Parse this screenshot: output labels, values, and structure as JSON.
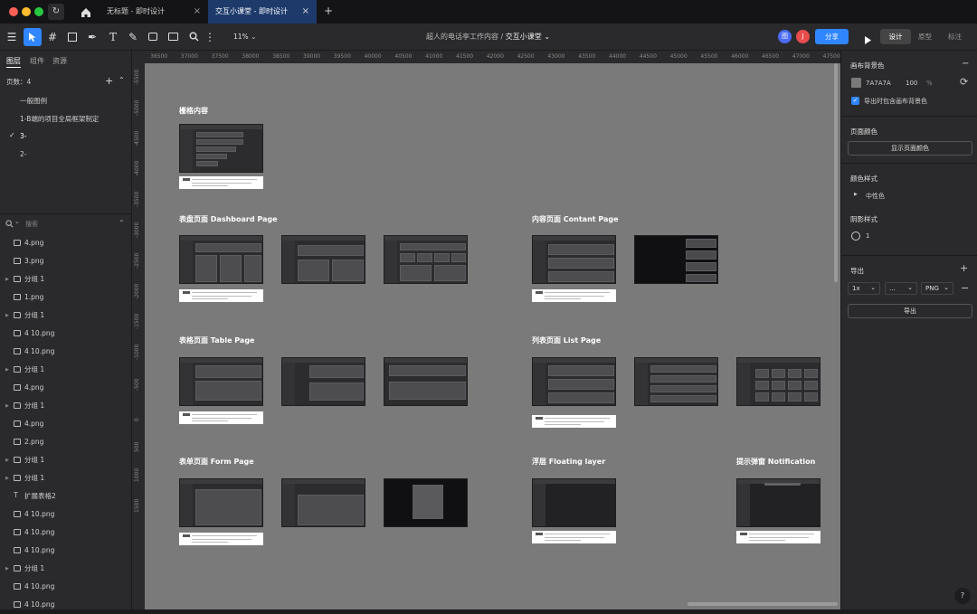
{
  "window": {
    "traffic_lights": [
      "#ff5f57",
      "#febc2e",
      "#28c840"
    ],
    "tabs": [
      {
        "label": "无标题 - 即时设计",
        "active": false
      },
      {
        "label": "交互小课堂 - 即时设计",
        "active": true
      }
    ],
    "new_tab": "+"
  },
  "toolbar": {
    "zoom": "11%",
    "breadcrumb_project": "超人的电话亭工作内容",
    "breadcrumb_sep": "/",
    "breadcrumb_file": "交互小课堂",
    "avatar1": "图",
    "avatar2": "J",
    "share_label": "分享",
    "mode_design": "设计",
    "mode_prototype": "原型",
    "mode_annotate": "标注",
    "colors": {
      "accent": "#2f86ff",
      "avatar1": "#4a6cf7",
      "avatar2": "#e84d4d"
    }
  },
  "left_panel": {
    "tabs": [
      "图层",
      "组件",
      "资源"
    ],
    "pages_label": "页数：",
    "pages_count": "4",
    "pages": [
      {
        "name": "一般图例",
        "checked": false
      },
      {
        "name": "1-B端的项目全局框架制定",
        "checked": false
      },
      {
        "name": "3-",
        "checked": true
      },
      {
        "name": "2-",
        "checked": false
      }
    ],
    "search_placeholder": "搜索",
    "layers": [
      {
        "name": "4.png",
        "type": "image",
        "expandable": false
      },
      {
        "name": "3.png",
        "type": "image",
        "expandable": false
      },
      {
        "name": "分组 1",
        "type": "folder",
        "expandable": true
      },
      {
        "name": "1.png",
        "type": "image",
        "expandable": false
      },
      {
        "name": "分组 1",
        "type": "folder",
        "expandable": true
      },
      {
        "name": "4 10.png",
        "type": "image",
        "expandable": false
      },
      {
        "name": "4 10.png",
        "type": "image",
        "expandable": false
      },
      {
        "name": "分组 1",
        "type": "folder",
        "expandable": true
      },
      {
        "name": "4.png",
        "type": "image",
        "expandable": false
      },
      {
        "name": "分组 1",
        "type": "folder",
        "expandable": true
      },
      {
        "name": "4.png",
        "type": "image",
        "expandable": false
      },
      {
        "name": "2.png",
        "type": "image",
        "expandable": false
      },
      {
        "name": "分组 1",
        "type": "folder",
        "expandable": true
      },
      {
        "name": "分组 1",
        "type": "folder",
        "expandable": true
      },
      {
        "name": "扩展表格2",
        "type": "text",
        "expandable": false
      },
      {
        "name": "4 10.png",
        "type": "image",
        "expandable": false
      },
      {
        "name": "4 10.png",
        "type": "image",
        "expandable": false
      },
      {
        "name": "4 10.png",
        "type": "image",
        "expandable": false
      },
      {
        "name": "分组 1",
        "type": "folder",
        "expandable": true
      },
      {
        "name": "4 10.png",
        "type": "image",
        "expandable": false
      },
      {
        "name": "4 10.png",
        "type": "image",
        "expandable": false
      }
    ]
  },
  "rulers": {
    "top": [
      "36500",
      "37000",
      "37500",
      "38000",
      "38500",
      "39000",
      "39500",
      "40000",
      "40500",
      "41000",
      "41500",
      "42000",
      "42500",
      "43000",
      "43500",
      "44000",
      "44500",
      "45000",
      "45500",
      "46000",
      "46500",
      "47000",
      "47500"
    ],
    "left": [
      "-5500",
      "-5000",
      "-4500",
      "-4000",
      "-3500",
      "-3000",
      "-2500",
      "-2000",
      "-1500",
      "-1000",
      "-500",
      "0",
      "500",
      "1000",
      "1500"
    ]
  },
  "canvas": {
    "background": "#7a7a7a",
    "sections": {
      "grid": "栅格内容",
      "dashboard": "表盘页面 Dashboard Page",
      "content": "内容页面 Contant Page",
      "table": "表格页面 Table Page",
      "list": "列表页面 List Page",
      "form": "表单页面 Form Page",
      "floating": "浮层 Floating layer",
      "notification": "提示弹窗 Notification"
    }
  },
  "right_panel": {
    "canvas_bg_label": "画布背景色",
    "canvas_bg_hex": "7A7A7A",
    "canvas_bg_opacity": "100",
    "percent": "%",
    "export_include_bg": "导出时包含画布背景色",
    "page_color_label": "页面颜色",
    "page_color_button": "显示页面颜色",
    "color_styles_label": "颜色样式",
    "color_style_item": "中性色",
    "shadow_styles_label": "阴影样式",
    "shadow_count": "1",
    "export_label": "导出",
    "export_scale": "1x",
    "export_suffix": "...",
    "export_format": "PNG",
    "export_button": "导出",
    "help": "?"
  }
}
